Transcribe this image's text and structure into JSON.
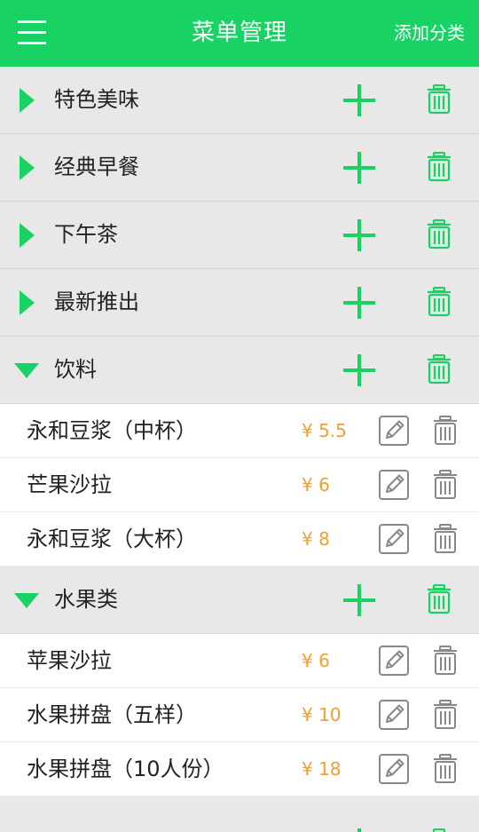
{
  "header": {
    "title": "菜单管理",
    "add_category_label": "添加分类",
    "accent_color": "#18d264"
  },
  "categories": [
    {
      "name": "特色美味",
      "expanded": false,
      "items": []
    },
    {
      "name": "经典早餐",
      "expanded": false,
      "items": []
    },
    {
      "name": "下午茶",
      "expanded": false,
      "items": []
    },
    {
      "name": "最新推出",
      "expanded": false,
      "items": []
    },
    {
      "name": "饮料",
      "expanded": true,
      "items": [
        {
          "name": "永和豆浆（中杯）",
          "price": "¥ 5.5"
        },
        {
          "name": "芒果沙拉",
          "price": "¥ 6"
        },
        {
          "name": "永和豆浆（大杯）",
          "price": "¥ 8"
        }
      ]
    },
    {
      "name": "水果类",
      "expanded": true,
      "items": [
        {
          "name": "苹果沙拉",
          "price": "¥ 6"
        },
        {
          "name": "水果拼盘（五样）",
          "price": "¥ 10"
        },
        {
          "name": "水果拼盘（10人份）",
          "price": "¥ 18"
        }
      ]
    }
  ],
  "icons": {
    "menu": "menu-icon",
    "expand_collapsed": "triangle-right-icon",
    "expand_open": "triangle-down-icon",
    "add": "plus-icon",
    "delete": "trash-icon",
    "edit": "edit-icon"
  },
  "colors": {
    "accent": "#18d264",
    "price": "#f0a030",
    "category_bg": "#e8e8e8",
    "icon_gray": "#888888"
  }
}
